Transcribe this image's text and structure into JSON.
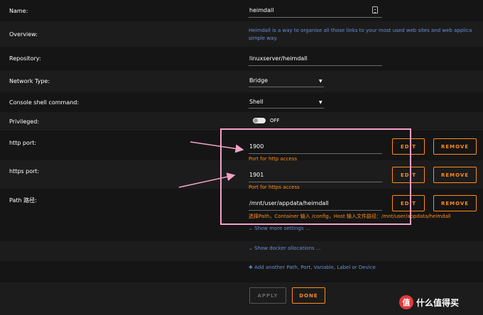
{
  "fields": {
    "name": {
      "label": "Name:",
      "value": "heimdall"
    },
    "overview": {
      "label": "Overview:",
      "line1": "Heimdall is a way to organise all those links to your most used web sites and web applica",
      "line2": "simple way."
    },
    "repository": {
      "label": "Repository:",
      "value": "linuxserver/heimdall"
    },
    "network_type": {
      "label": "Network Type:",
      "value": "Bridge"
    },
    "console_shell": {
      "label": "Console shell command:",
      "value": "Shell"
    },
    "privileged": {
      "label": "Privileged:",
      "state": "OFF"
    },
    "http_port": {
      "label": "http port:",
      "value": "1900",
      "hint": "Port for http access"
    },
    "https_port": {
      "label": "https port:",
      "value": "1901",
      "hint": "Port for https access"
    },
    "path": {
      "label": "Path 路径:",
      "value": "/mnt/user/appdata/heimdall",
      "hint": "选择Path，Container 输入 /config，Host 输入文件路径：/mnt/user/appdata/heimdall"
    }
  },
  "buttons": {
    "edit": "EDIT",
    "remove": "REMOVE",
    "apply": "APPLY",
    "done": "DONE"
  },
  "links": {
    "show_more": "Show more settings ...",
    "show_docker": "Show docker allocations ...",
    "add_another": "Add another Path, Port, Variable, Label or Device"
  },
  "watermark": {
    "badge": "值",
    "text": "什么值得买"
  },
  "colors": {
    "accent": "#ff8c1a",
    "link": "#6a8fd6",
    "highlight": "#f3a0c8"
  },
  "icons": [
    "copy-icon",
    "caret-down-icon",
    "chevron-down-icon",
    "plus-icon"
  ]
}
